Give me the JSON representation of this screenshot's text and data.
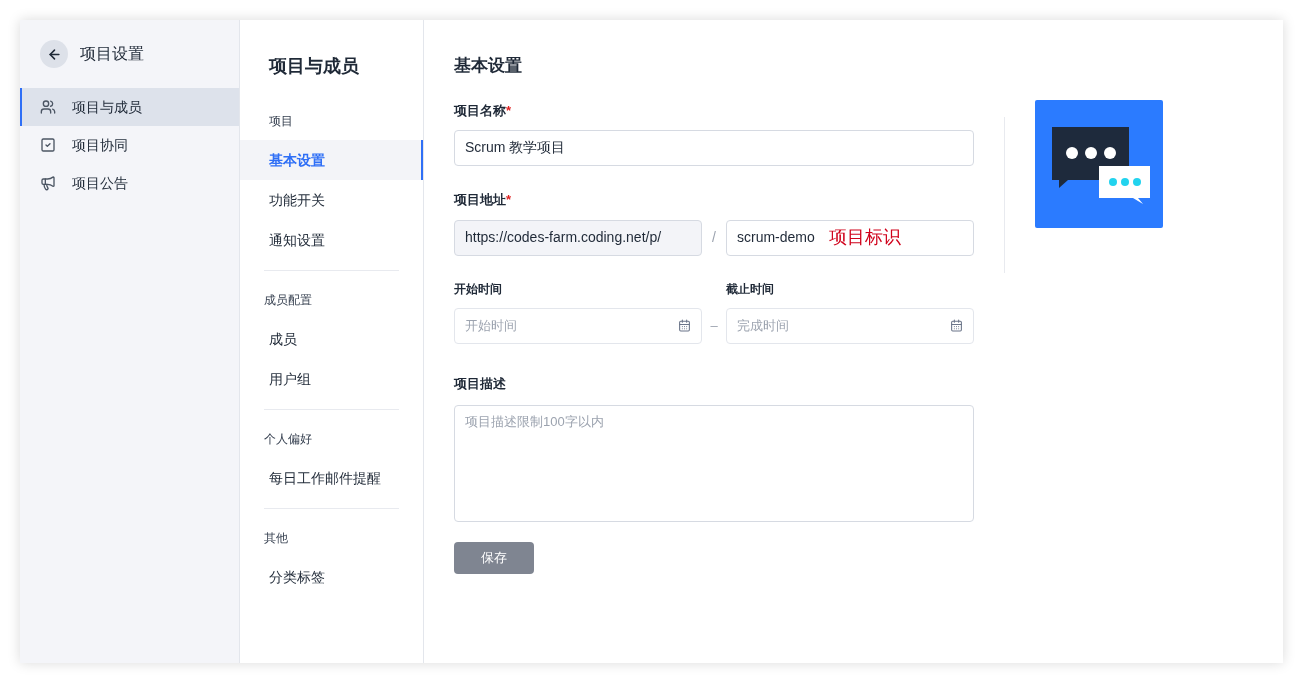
{
  "sidebar": {
    "title": "项目设置",
    "items": [
      {
        "label": "项目与成员",
        "kind": "members",
        "selected": true
      },
      {
        "label": "项目协同",
        "kind": "collab",
        "selected": false
      },
      {
        "label": "项目公告",
        "kind": "notice",
        "selected": false
      }
    ]
  },
  "subnav": {
    "title": "项目与成员",
    "sections": [
      {
        "heading": "项目",
        "items": [
          {
            "label": "基本设置",
            "selected": true
          },
          {
            "label": "功能开关",
            "selected": false
          },
          {
            "label": "通知设置",
            "selected": false
          }
        ]
      },
      {
        "heading": "成员配置",
        "items": [
          {
            "label": "成员",
            "selected": false
          },
          {
            "label": "用户组",
            "selected": false
          }
        ]
      },
      {
        "heading": "个人偏好",
        "items": [
          {
            "label": "每日工作邮件提醒",
            "selected": false
          }
        ]
      },
      {
        "heading": "其他",
        "items": [
          {
            "label": "分类标签",
            "selected": false
          }
        ]
      }
    ]
  },
  "form": {
    "title": "基本设置",
    "name": {
      "label": "项目名称",
      "required_mark": "*",
      "value": "Scrum 教学项目"
    },
    "address": {
      "label": "项目地址",
      "required_mark": "*",
      "prefix": "https://codes-farm.coding.net/p/",
      "separator": "/",
      "value": "scrum-demo",
      "annotation": "项目标识"
    },
    "start": {
      "label": "开始时间",
      "placeholder": "开始时间"
    },
    "range_separator": "–",
    "end": {
      "label": "截止时间",
      "placeholder": "完成时间"
    },
    "description": {
      "label": "项目描述",
      "placeholder": "项目描述限制100字以内"
    },
    "save_button": "保存"
  }
}
